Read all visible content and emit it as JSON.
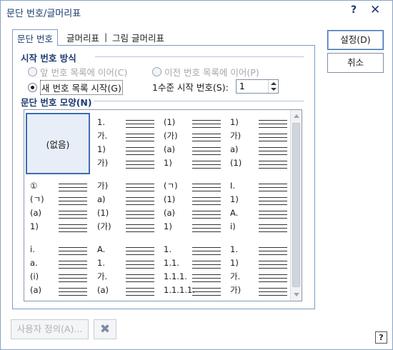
{
  "title": "문단 번호/글머리표",
  "title_help": "?",
  "title_close": "✕",
  "tabs": [
    "문단 번호",
    "글머리표",
    "그림 글머리표"
  ],
  "tab_separator": "|",
  "start_method": {
    "label": "시작 번호 방식",
    "options": [
      "앞 번호 목록에 이어(C)",
      "이전 번호 목록에 이어(P)",
      "새 번호 목록 시작(G)"
    ],
    "selected": "새 번호 목록 시작(G)"
  },
  "level1_start": {
    "label": "1수준 시작 번호(S):",
    "value": "1"
  },
  "shape_label": "문단 번호 모양(N)",
  "gallery": [
    {
      "none": "(없음)"
    },
    {
      "labels": [
        "1.",
        "가.",
        "1)",
        "가)"
      ]
    },
    {
      "labels": [
        "(1)",
        "(가)",
        "(a)",
        "1)"
      ]
    },
    {
      "labels": [
        "1)",
        "가)",
        "a)",
        "(1)"
      ]
    },
    {
      "labels": [
        "①",
        "(ㄱ)",
        "(a)",
        "1)"
      ]
    },
    {
      "labels": [
        "가)",
        "a)",
        "(1)",
        "(가)"
      ]
    },
    {
      "labels": [
        "(ㄱ)",
        "(1)",
        "(a)",
        "1)"
      ]
    },
    {
      "labels": [
        "I.",
        "1)",
        "A.",
        "i)"
      ]
    },
    {
      "labels": [
        "i.",
        "a.",
        "(i)",
        "(a)"
      ]
    },
    {
      "labels": [
        "A.",
        "1.",
        "가.",
        "(a)"
      ]
    },
    {
      "labels": [
        "1.",
        "1.1.",
        "1.1.1.",
        "1.1.1.1."
      ]
    },
    {
      "labels": [
        "1.",
        "1)",
        "가.",
        "가)"
      ]
    }
  ],
  "buttons": {
    "ok": "설정(D)",
    "cancel": "취소",
    "user_define": "사용자 정의(A)...",
    "delete_icon": "✖",
    "help": "?"
  },
  "colors": {
    "accent": "#3b6db3",
    "title_text": "#1b3b6f"
  }
}
